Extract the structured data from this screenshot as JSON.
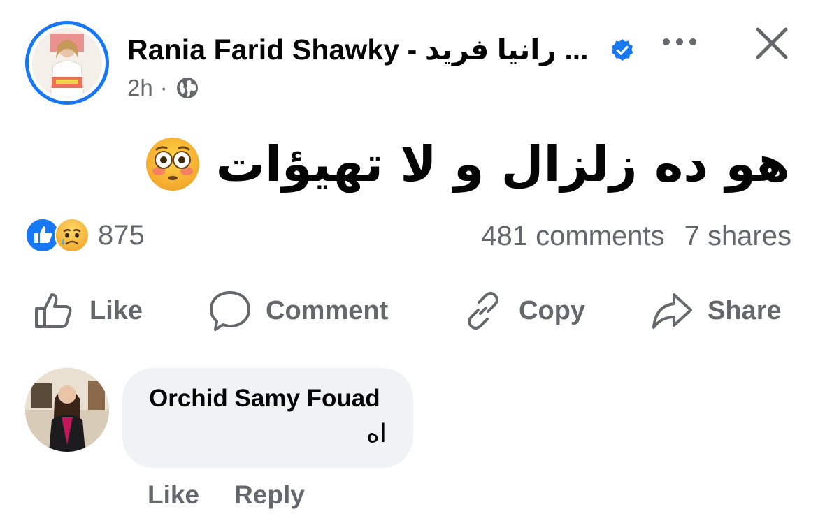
{
  "post": {
    "author": "Rania Farid Shawky - رانيا  فريد ...",
    "time": "2h",
    "separator": "·",
    "text": "هو ده زلزال و لا تهيؤات",
    "reaction_count": "875",
    "comments": "481 comments",
    "shares": "7 shares"
  },
  "actions": {
    "like": "Like",
    "comment": "Comment",
    "copy": "Copy",
    "share": "Share"
  },
  "comment": {
    "author": "Orchid Samy Fouad",
    "text": "اه",
    "like": "Like",
    "reply": "Reply"
  },
  "icons": [
    "verified-badge-icon",
    "globe-icon",
    "more-icon",
    "close-icon",
    "flushed-emoji-icon",
    "like-reaction-icon",
    "sad-reaction-icon",
    "thumbs-up-icon",
    "comment-bubble-icon",
    "link-icon",
    "share-arrow-icon"
  ],
  "colors": {
    "brand": "#1877f2",
    "muted": "#65676b",
    "bubble": "#f0f2f5",
    "text": "#050505"
  }
}
